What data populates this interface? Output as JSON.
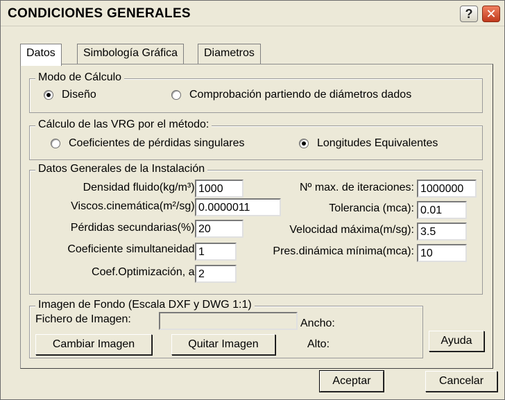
{
  "window": {
    "title": "CONDICIONES GENERALES"
  },
  "titlebar": {
    "help_glyph": "?",
    "close_glyph": "✕"
  },
  "tabs": [
    {
      "label": "Datos",
      "active": true
    },
    {
      "label": "Simbología Gráfica",
      "active": false
    },
    {
      "label": "Diametros",
      "active": false
    }
  ],
  "modo_calculo": {
    "legend": "Modo de Cálculo",
    "options": [
      {
        "label": "Diseño",
        "selected": true
      },
      {
        "label": "Comprobación partiendo de diámetros dados",
        "selected": false
      }
    ]
  },
  "calculo_vrg": {
    "legend": "Cálculo de las VRG  por el método:",
    "options": [
      {
        "label": "Coeficientes de pérdidas singulares",
        "selected": false
      },
      {
        "label": "Longitudes Equivalentes",
        "selected": true
      }
    ]
  },
  "datos_generales": {
    "legend": "Datos Generales de la Instalación",
    "left": [
      {
        "label": "Densidad fluido(kg/m³):",
        "value": "1000"
      },
      {
        "label": "Viscos.cinemática(m²/sg):",
        "value": "0.0000011"
      },
      {
        "label": "Pérdidas secundarias(%):",
        "value": "20"
      },
      {
        "label": "Coeficiente simultaneidad:",
        "value": "1"
      },
      {
        "label": "Coef.Optimización, a:",
        "value": "2"
      }
    ],
    "right": [
      {
        "label": "Nº max. de iteraciones:",
        "value": "1000000"
      },
      {
        "label": "Tolerancia (mca):",
        "value": "0.01"
      },
      {
        "label": "Velocidad máxima(m/sg):",
        "value": "3.5"
      },
      {
        "label": "Pres.dinámica mínima(mca):",
        "value": "10"
      }
    ]
  },
  "imagen_fondo": {
    "legend": "Imagen de Fondo (Escala DXF y DWG 1:1)",
    "file_label": "Fichero de Imagen:",
    "file_value": "",
    "ancho_label": "Ancho:",
    "alto_label": "Alto:",
    "change_button": "Cambiar Imagen",
    "remove_button": "Quitar Imagen"
  },
  "buttons": {
    "help": "Ayuda",
    "accept": "Aceptar",
    "cancel": "Cancelar"
  },
  "colors": {
    "face": "#ece9d8",
    "field": "#ffffff",
    "close": "#c0391c"
  }
}
